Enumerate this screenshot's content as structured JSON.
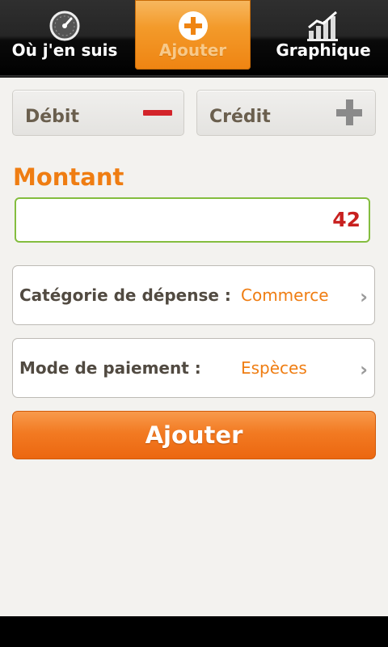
{
  "tabs": [
    {
      "label": "Où j'en suis",
      "icon": "speedometer-icon"
    },
    {
      "label": "Ajouter",
      "icon": "plus-circle-icon"
    },
    {
      "label": "Graphique",
      "icon": "bar-chart-icon"
    }
  ],
  "toggles": {
    "debit_label": "Débit",
    "credit_label": "Crédit",
    "debit_icon": "minus-icon",
    "credit_icon": "plus-icon"
  },
  "amount": {
    "title": "Montant",
    "value": "42"
  },
  "category": {
    "label": "Catégorie de dépense :",
    "value": "Commerce"
  },
  "payment": {
    "label": "Mode de paiement :",
    "value": "Espèces"
  },
  "submit_label": "Ajouter",
  "colors": {
    "accent": "#ef7d12",
    "amount_value": "#c8201f",
    "field_border": "#84bd3f",
    "debit_minus": "#d3242a"
  }
}
